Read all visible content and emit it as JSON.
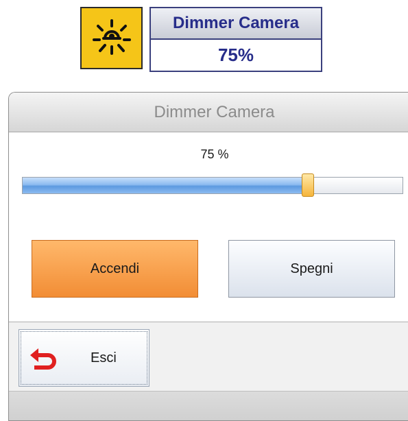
{
  "widget": {
    "title": "Dimmer Camera",
    "value": "75%",
    "icon": "light-bulb-icon",
    "icon_bg": "#f5c518"
  },
  "dialog": {
    "title": "Dimmer Camera",
    "level_label": "75 %",
    "slider": {
      "value": 0.75
    },
    "buttons": {
      "on_label": "Accendi",
      "off_label": "Spegni"
    },
    "exit": {
      "label": "Esci",
      "icon": "undo-arrow-icon",
      "icon_color": "#e02020"
    }
  }
}
